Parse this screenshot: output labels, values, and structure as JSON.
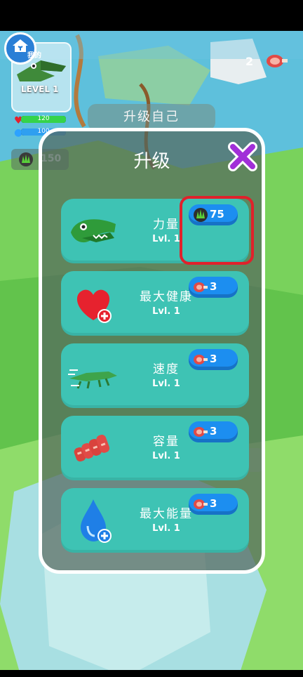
{
  "hud": {
    "home_label": "我的",
    "level_label": "LEVEL 1",
    "health_value": "120",
    "energy_value": "100",
    "claw_currency": "150",
    "meat_count": "2",
    "upgrade_self_label": "升级自己",
    "ghost_button_label": "升级"
  },
  "panel": {
    "title": "升级",
    "items": [
      {
        "name": "力量",
        "level": "Lvl. 1",
        "cost": "75",
        "cost_icon": "claw-icon",
        "icon": "crocodile-head-icon"
      },
      {
        "name": "最大健康",
        "level": "Lvl. 1",
        "cost": "3",
        "cost_icon": "meat-icon",
        "icon": "heart-plus-icon"
      },
      {
        "name": "速度",
        "level": "Lvl. 1",
        "cost": "3",
        "cost_icon": "meat-icon",
        "icon": "running-crocodile-icon"
      },
      {
        "name": "容量",
        "level": "Lvl. 1",
        "cost": "3",
        "cost_icon": "meat-icon",
        "icon": "meat-stack-icon"
      },
      {
        "name": "最大能量",
        "level": "Lvl. 1",
        "cost": "3",
        "cost_icon": "meat-icon",
        "icon": "water-drop-plus-icon"
      }
    ]
  },
  "colors": {
    "card": "#3ec3b4",
    "cost_button": "#1c8ef0",
    "highlight": "#e0212b",
    "close": "#a12fd8"
  }
}
